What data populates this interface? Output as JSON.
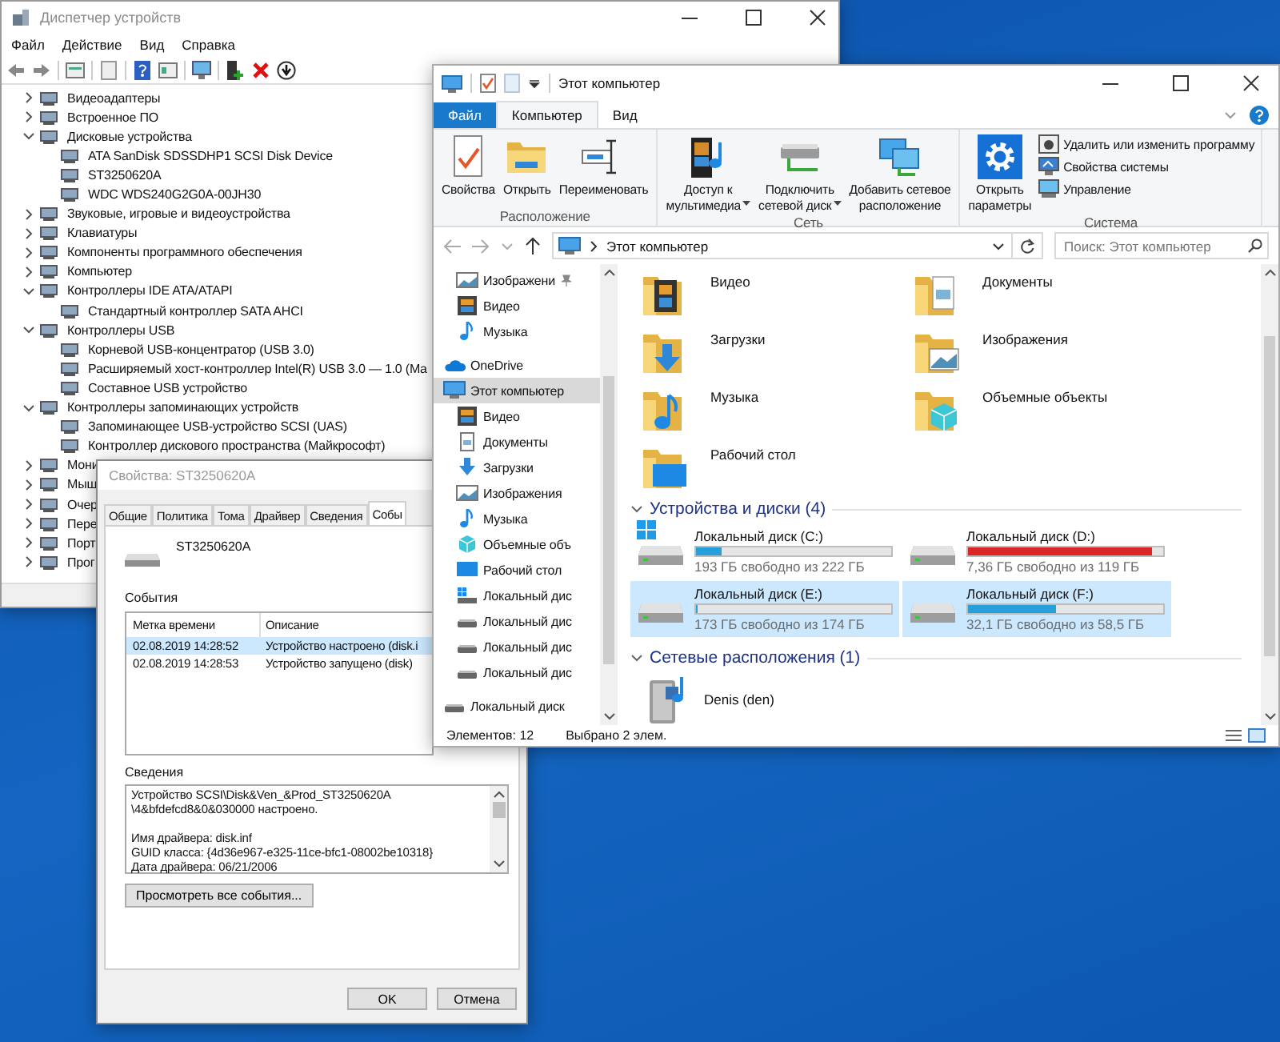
{
  "device_manager": {
    "title": "Диспетчер устройств",
    "menu": [
      "Файл",
      "Действие",
      "Вид",
      "Справка"
    ],
    "tree": [
      {
        "label": "Видеоадаптеры",
        "expanded": false
      },
      {
        "label": "Встроенное ПО",
        "expanded": false
      },
      {
        "label": "Дисковые устройства",
        "expanded": true,
        "children": [
          {
            "label": "ATA SanDisk SDSSDHP1 SCSI Disk Device"
          },
          {
            "label": "ST3250620A"
          },
          {
            "label": "WDC WDS240G2G0A-00JH30"
          }
        ]
      },
      {
        "label": "Звуковые, игровые и видеоустройства",
        "expanded": false
      },
      {
        "label": "Клавиатуры",
        "expanded": false
      },
      {
        "label": "Компоненты программного обеспечения",
        "expanded": false
      },
      {
        "label": "Компьютер",
        "expanded": false
      },
      {
        "label": "Контроллеры IDE ATA/ATAPI",
        "expanded": true,
        "children": [
          {
            "label": "Стандартный контроллер SATA AHCI"
          }
        ]
      },
      {
        "label": "Контроллеры USB",
        "expanded": true,
        "children": [
          {
            "label": "Корневой USB-концентратор (USB 3.0)"
          },
          {
            "label": "Расширяемый хост-контроллер Intel(R) USB 3.0 — 1.0 (Ma"
          },
          {
            "label": "Составное USB устройство"
          }
        ]
      },
      {
        "label": "Контроллеры запоминающих устройств",
        "expanded": true,
        "children": [
          {
            "label": "Запоминающее USB-устройство SCSI (UAS)"
          },
          {
            "label": "Контроллер дискового пространства (Майкрософт)"
          }
        ]
      },
      {
        "label": "Мони",
        "expanded": false
      },
      {
        "label": "Мыш",
        "expanded": false
      },
      {
        "label": "Очер",
        "expanded": false
      },
      {
        "label": "Пере",
        "expanded": false
      },
      {
        "label": "Порт",
        "expanded": false
      },
      {
        "label": "Прог",
        "expanded": false
      }
    ]
  },
  "properties_dialog": {
    "title": "Свойства: ST3250620A",
    "tabs": [
      {
        "label": "Общие",
        "selected": false
      },
      {
        "label": "Политика",
        "selected": false
      },
      {
        "label": "Тома",
        "selected": false
      },
      {
        "label": "Драйвер",
        "selected": false
      },
      {
        "label": "Сведения",
        "selected": false
      },
      {
        "label": "Собы",
        "selected": true
      }
    ],
    "device_name": "ST3250620A",
    "events_label": "События",
    "events_columns": [
      "Метка времени",
      "Описание"
    ],
    "events": [
      {
        "time": "02.08.2019 14:28:52",
        "description": "Устройство настроено (disk.i",
        "selected": true
      },
      {
        "time": "02.08.2019 14:28:53",
        "description": "Устройство запущено (disk)",
        "selected": false
      }
    ],
    "details_label": "Сведения",
    "details_paragraphs": [
      [
        "Устройство SCSI\\Disk&Ven_&Prod_ST3250620A",
        "\\4&bfdefcd8&0&030000 настроено."
      ],
      [
        "Имя драйвера: disk.inf",
        "GUID класса: {4d36e967-e325-11ce-bfc1-08002be10318}",
        "Дата драйвера: 06/21/2006"
      ]
    ],
    "view_all_button": "Просмотреть все события...",
    "buttons": [
      "OK",
      "Отмена"
    ]
  },
  "explorer": {
    "title": "Этот компьютер",
    "ribbon_tabs": [
      {
        "label": "Файл",
        "kind": "file",
        "selected": false
      },
      {
        "label": "Компьютер",
        "kind": "tab",
        "selected": true
      },
      {
        "label": "Вид",
        "kind": "tab",
        "selected": false
      }
    ],
    "ribbon_groups": [
      {
        "label": "Расположение",
        "buttons": [
          {
            "lines": [
              "Свойства"
            ],
            "kind": "properties",
            "dropdown": false
          },
          {
            "lines": [
              "Открыть"
            ],
            "kind": "open",
            "dropdown": false
          },
          {
            "lines": [
              "Переименовать"
            ],
            "kind": "rename",
            "dropdown": false
          }
        ]
      },
      {
        "label": "Сеть",
        "buttons": [
          {
            "lines": [
              "Доступ к",
              "мультимедиа"
            ],
            "kind": "media",
            "dropdown": true
          },
          {
            "lines": [
              "Подключить",
              "сетевой диск"
            ],
            "kind": "map-drive",
            "dropdown": true
          },
          {
            "lines": [
              "Добавить сетевое",
              "расположение"
            ],
            "kind": "add-location",
            "dropdown": false
          }
        ]
      },
      {
        "label": "Система",
        "buttons": [
          {
            "lines": [
              "Открыть",
              "параметры"
            ],
            "kind": "settings",
            "dropdown": false
          }
        ],
        "small_buttons": [
          {
            "label": "Удалить или изменить программу",
            "kind": "uninstall"
          },
          {
            "label": "Свойства системы",
            "kind": "system-properties"
          },
          {
            "label": "Управление",
            "kind": "manage"
          }
        ]
      }
    ],
    "address": "Этот компьютер",
    "search_placeholder": "Поиск: Этот компьютер",
    "quick_access": [
      {
        "label": "Изображени",
        "kind": "pictures",
        "pinned": true,
        "selected": false
      },
      {
        "label": "Видео",
        "kind": "videos",
        "pinned": false,
        "selected": false
      },
      {
        "label": "Музыка",
        "kind": "music",
        "pinned": false,
        "selected": false
      }
    ],
    "nav": [
      {
        "label": "OneDrive",
        "kind": "cloud",
        "selected": false
      },
      {
        "label": "Этот компьютер",
        "kind": "computer",
        "selected": true,
        "children": [
          {
            "label": "Видео",
            "kind": "videos",
            "selected": false
          },
          {
            "label": "Документы",
            "kind": "documents",
            "selected": false
          },
          {
            "label": "Загрузки",
            "kind": "downloads",
            "selected": false
          },
          {
            "label": "Изображения",
            "kind": "pictures",
            "selected": false
          },
          {
            "label": "Музыка",
            "kind": "music",
            "selected": false
          },
          {
            "label": "Объемные объ",
            "kind": "objects3d",
            "selected": false
          },
          {
            "label": "Рабочий стол",
            "kind": "desktop",
            "selected": false
          },
          {
            "label": "Локальный дис",
            "kind": "system-drive",
            "selected": false
          },
          {
            "label": "Локальный дис",
            "kind": "drive",
            "selected": false
          },
          {
            "label": "Локальный дис",
            "kind": "drive",
            "selected": false
          },
          {
            "label": "Локальный дис",
            "kind": "drive",
            "selected": false
          }
        ]
      },
      {
        "label": "Локальный диск",
        "kind": "drive",
        "selected": false
      }
    ],
    "folders": [
      {
        "label": "Видео",
        "kind": "videos"
      },
      {
        "label": "Документы",
        "kind": "documents"
      },
      {
        "label": "Загрузки",
        "kind": "downloads"
      },
      {
        "label": "Изображения",
        "kind": "pictures"
      },
      {
        "label": "Музыка",
        "kind": "music"
      },
      {
        "label": "Объемные объекты",
        "kind": "objects3d"
      },
      {
        "label": "Рабочий стол",
        "kind": "desktop"
      }
    ],
    "devices_section": "Устройства и диски (4)",
    "drives": [
      {
        "name": "Локальный диск (C:)",
        "free": "193 ГБ свободно из 222 ГБ",
        "level": 0.13,
        "system": true,
        "selected": false
      },
      {
        "name": "Локальный диск (D:)",
        "free": "7,36 ГБ свободно из 119 ГБ",
        "level": 0.94,
        "system": false,
        "selected": false
      },
      {
        "name": "Локальный диск (E:)",
        "free": "173 ГБ свободно из 174 ГБ",
        "level": 0.01,
        "system": false,
        "selected": true
      },
      {
        "name": "Локальный диск (F:)",
        "free": "32,1 ГБ свободно из 58,5 ГБ",
        "level": 0.45,
        "system": false,
        "selected": true
      }
    ],
    "network_section": "Сетевые расположения (1)",
    "network": [
      {
        "label": "Denis (den)"
      }
    ],
    "status": {
      "items": "Элементов: 12",
      "selection": "Выбрано 2 элем."
    }
  }
}
